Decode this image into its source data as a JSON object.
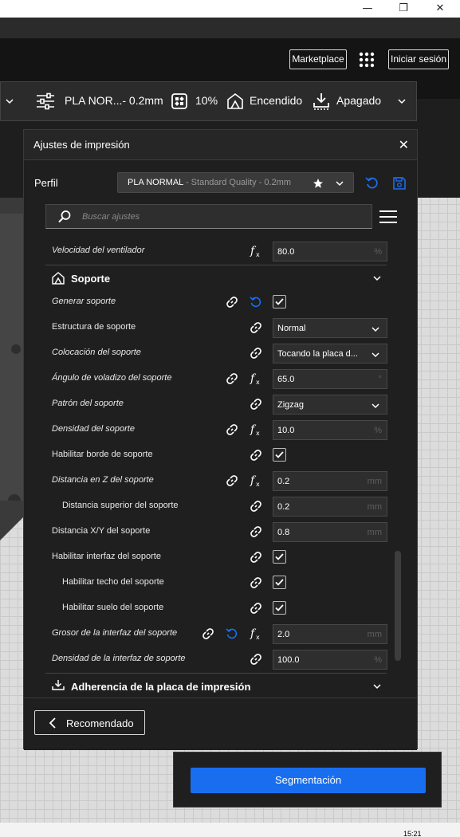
{
  "window": {
    "minimize_glyph": "—",
    "maximize_glyph": "❐",
    "close_glyph": "✕"
  },
  "header": {
    "marketplace_label": "Marketplace",
    "signin_label": "Iniciar sesión"
  },
  "print_bar": {
    "profile_summary": "PLA NOR...- 0.2mm",
    "infill": "10%",
    "support": "Encendido",
    "adhesion": "Apagado"
  },
  "panel": {
    "title": "Ajustes de impresión",
    "close_glyph": "✕",
    "profile_label": "Perfil",
    "profile_name": "PLA NORMAL",
    "profile_detail": " - Standard Quality - 0.2mm",
    "search_placeholder": "Buscar ajustes"
  },
  "settings": {
    "fan_speed": {
      "label": "Velocidad del ventilador",
      "value": "80.0",
      "unit": "%"
    },
    "support_section": "Soporte",
    "generate_support": {
      "label": "Generar soporte"
    },
    "support_structure": {
      "label": "Estructura de soporte",
      "value": "Normal"
    },
    "support_placement": {
      "label": "Colocación del soporte",
      "value": "Tocando la placa d..."
    },
    "overhang_angle": {
      "label": "Ángulo de voladizo del soporte",
      "value": "65.0",
      "unit": "°"
    },
    "support_pattern": {
      "label": "Patrón del soporte",
      "value": "Zigzag"
    },
    "support_density": {
      "label": "Densidad del soporte",
      "value": "10.0",
      "unit": "%"
    },
    "support_brim": {
      "label": "Habilitar borde de soporte"
    },
    "z_distance": {
      "label": "Distancia en Z del soporte",
      "value": "0.2",
      "unit": "mm"
    },
    "top_distance": {
      "label": "Distancia superior del soporte",
      "value": "0.2",
      "unit": "mm"
    },
    "xy_distance": {
      "label": "Distancia X/Y del soporte",
      "value": "0.8",
      "unit": "mm"
    },
    "interface_enable": {
      "label": "Habilitar interfaz del soporte"
    },
    "roof_enable": {
      "label": "Habilitar techo del soporte"
    },
    "floor_enable": {
      "label": "Habilitar suelo del soporte"
    },
    "interface_thickness": {
      "label": "Grosor de la interfaz del soporte",
      "value": "2.0",
      "unit": "mm"
    },
    "interface_density": {
      "label": "Densidad de la interfaz de soporte",
      "value": "100.0",
      "unit": "%"
    },
    "adhesion_section": "Adherencia de la placa de impresión"
  },
  "footer": {
    "recommended_label": "Recomendado",
    "slice_label": "Segmentación"
  },
  "taskbar": {
    "time": "15:21"
  },
  "colors": {
    "accent": "#196ef0",
    "panel": "#1f1f1f"
  }
}
